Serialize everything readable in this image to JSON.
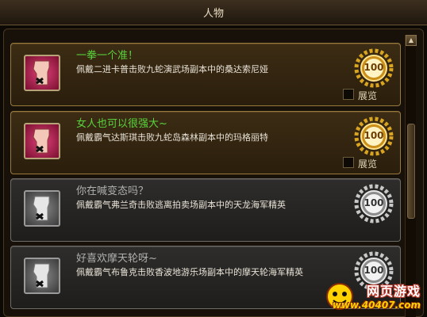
{
  "window": {
    "title": "人物"
  },
  "achievements": [
    {
      "title": "一拳一个准！",
      "desc": "佩戴二进卡普击败九蛇演武场副本中的桑达索尼娅",
      "points": "100",
      "completed": true,
      "checkbox_label": "展览"
    },
    {
      "title": "女人也可以很强大~",
      "desc": "佩戴霸气达斯琪击败九蛇岛森林副本中的玛格丽特",
      "points": "100",
      "completed": true,
      "checkbox_label": "展览"
    },
    {
      "title": "你在喊变态吗？",
      "desc": "佩戴霸气弗兰奇击败逃离拍卖场副本中的天龙海军精英",
      "points": "100",
      "completed": false
    },
    {
      "title": "好喜欢摩天轮呀~",
      "desc": "佩戴霸气布鲁克击败香波地游乐场副本中的摩天轮海军精英",
      "points": "100",
      "completed": false
    }
  ],
  "watermark": {
    "line1": "网页游戏",
    "line2": "www.40407.com"
  },
  "colors": {
    "completed_title": "#59d43c",
    "pending_title": "#b0b0b0",
    "gold": "#d9a520",
    "silver": "#c8c8c8"
  },
  "icons": {
    "achievement": "fist-icon",
    "locked": "x-mark-icon",
    "medal": "medal-icon"
  }
}
